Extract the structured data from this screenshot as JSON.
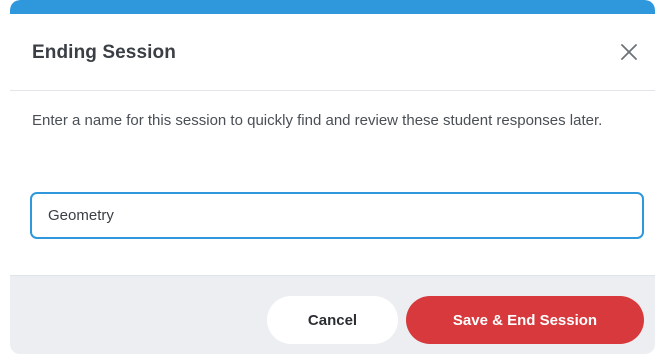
{
  "dialog": {
    "title": "Ending Session",
    "description": "Enter a name for this session to quickly find and review these student responses later.",
    "close_icon": "close-icon",
    "colors": {
      "accent": "#2f98dc",
      "primary_button": "#d7393d",
      "footer_background": "#eceef1"
    }
  },
  "session_name_field": {
    "value": "Geometry",
    "placeholder": ""
  },
  "footer": {
    "cancel_label": "Cancel",
    "confirm_label": "Save & End Session"
  }
}
